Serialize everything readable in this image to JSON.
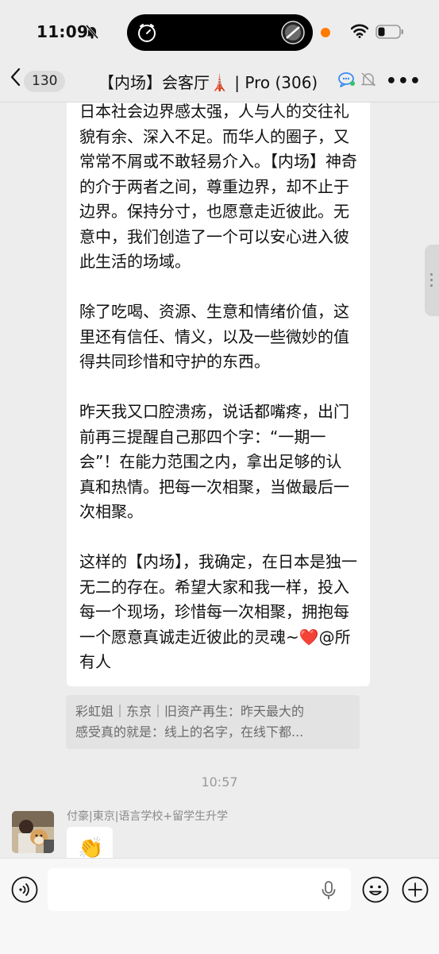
{
  "status_bar": {
    "time": "11:09"
  },
  "nav": {
    "unread_count": "130",
    "title": "【内场】会客厅🗼 | Pro (306)",
    "more": "•••"
  },
  "message": {
    "paragraphs": [
      "日本社会边界感太强，人与人的交往礼貌有余、深入不足。而华人的圈子，又常常不屑或不敢轻易介入。【内场】神奇的介于两者之间，尊重边界，却不止于边界。保持分寸，也愿意走近彼此。无意中，我们创造了一个可以安心进入彼此生活的场域。",
      "除了吃喝、资源、生意和情绪价值，这里还有信任、情义，以及一些微妙的值得共同珍惜和守护的东西。",
      "昨天我又口腔溃疡，说话都嘴疼，出门前再三提醒自己那四个字：“一期一会”！在能力范围之内，拿出足够的认真和热情。把每一次相聚，当做最后一次相聚。"
    ],
    "last_paragraph_text": "这样的【内场】，我确定，在日本是独一无二的存在。希望大家和我一样，投入每一个现场，珍惜每一次相聚，拥抱每一个愿意真诚走近彼此的灵魂~",
    "heart": "❤️",
    "mention": "@所有人"
  },
  "quote": {
    "line1": "彩虹姐｜东京｜旧资产再生：昨天最大的",
    "line2": "感受真的就是：线上的名字，在线下都..."
  },
  "time_divider": "10:57",
  "reply": {
    "sender": "付豪|東京|语言学校+留学生升学",
    "emoji": "👏"
  },
  "input": {
    "value": "",
    "placeholder": ""
  }
}
